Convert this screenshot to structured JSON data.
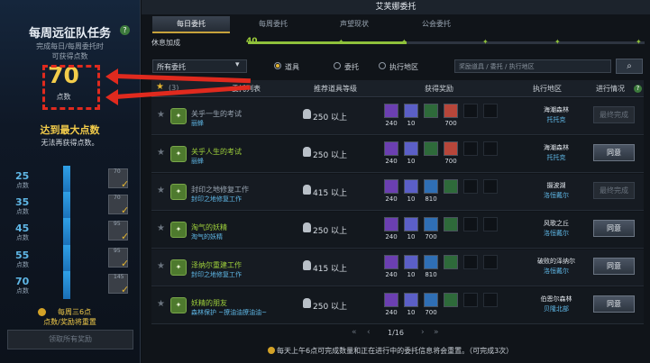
{
  "left": {
    "title": "每周远征队任务",
    "subtitle1": "完成每日/每周委托时",
    "subtitle2": "可获得点数",
    "points": "70",
    "points_unit": "点数",
    "maxed": "达到最大点数",
    "maxed_sub": "无法再获得点数。",
    "tiers": [
      {
        "num": "25",
        "unit": "点数",
        "count": "70"
      },
      {
        "num": "35",
        "unit": "点数",
        "count": "70"
      },
      {
        "num": "45",
        "unit": "点数",
        "count": "95"
      },
      {
        "num": "55",
        "unit": "点数",
        "count": "95"
      },
      {
        "num": "70",
        "unit": "点数",
        "count": "145"
      }
    ],
    "reset_note1": "每周三6点",
    "reset_note2": "点数/奖励将重置",
    "claim_all": "领取所有奖励"
  },
  "main": {
    "window_title": "艾芙娜委托",
    "tabs": [
      "每日委托",
      "每周委托",
      "声望现状",
      "公会委托"
    ],
    "rest_label": "休息加成",
    "rest_value": "40",
    "rest_fraction": 0.4,
    "filter": "所有委托",
    "radios": [
      "道具",
      "委托",
      "执行地区"
    ],
    "search_placeholder": "奖励道具 / 委托 / 执行地区",
    "header": {
      "count": "(3)",
      "list": "委托列表",
      "level": "推荐道具等级",
      "reward": "获得奖励",
      "region": "执行地区",
      "status": "进行情况"
    },
    "rows": [
      {
        "name": "关乎一生的考试",
        "giver": "丽蜂",
        "level": "250 以上",
        "rewards": [
          {
            "q": "240",
            "c": "#6b3fb1"
          },
          {
            "q": "10",
            "c": "#5b5fc7"
          },
          {
            "q": "",
            "c": "#2e6a3a"
          },
          {
            "q": "700",
            "c": "#b7463a"
          }
        ],
        "loc": "海潮森林",
        "loc2": "托托克",
        "btn": "最终完成",
        "active": false,
        "hl": false
      },
      {
        "name": "关乎人生的考试",
        "giver": "丽蜂",
        "level": "250 以上",
        "rewards": [
          {
            "q": "240",
            "c": "#6b3fb1"
          },
          {
            "q": "10",
            "c": "#5b5fc7"
          },
          {
            "q": "",
            "c": "#2e6a3a"
          },
          {
            "q": "700",
            "c": "#b7463a"
          }
        ],
        "loc": "海潮森林",
        "loc2": "托托克",
        "btn": "同意",
        "active": true,
        "hl": true
      },
      {
        "name": "封印之地修复工作",
        "giver": "封印之地修复工作",
        "level": "415 以上",
        "rewards": [
          {
            "q": "240",
            "c": "#6b3fb1"
          },
          {
            "q": "10",
            "c": "#5b5fc7"
          },
          {
            "q": "810",
            "c": "#2f6fb5"
          },
          {
            "q": "",
            "c": "#2e6a3a"
          }
        ],
        "loc": "摄波湖",
        "loc2": "洛恒戴尔",
        "btn": "最终完成",
        "active": false,
        "hl": false
      },
      {
        "name": "淘气的妖精",
        "giver": "淘气的妖精",
        "level": "250 以上",
        "rewards": [
          {
            "q": "240",
            "c": "#6b3fb1"
          },
          {
            "q": "10",
            "c": "#5b5fc7"
          },
          {
            "q": "700",
            "c": "#2f6fb5"
          },
          {
            "q": "",
            "c": "#2e6a3a"
          }
        ],
        "loc": "风歌之丘",
        "loc2": "洛恒戴尔",
        "btn": "同意",
        "active": true,
        "hl": true
      },
      {
        "name": "泽纳尔重建工作",
        "giver": "封印之地修复工作",
        "level": "415 以上",
        "rewards": [
          {
            "q": "240",
            "c": "#6b3fb1"
          },
          {
            "q": "10",
            "c": "#5b5fc7"
          },
          {
            "q": "810",
            "c": "#2f6fb5"
          },
          {
            "q": "",
            "c": "#2e6a3a"
          }
        ],
        "loc": "破败的泽纳尔",
        "loc2": "洛恒戴尔",
        "btn": "同意",
        "active": true,
        "hl": true
      },
      {
        "name": "妖精的朋友",
        "giver": "森林保护 ~撩油油撩油油~",
        "level": "250 以上",
        "rewards": [
          {
            "q": "240",
            "c": "#6b3fb1"
          },
          {
            "q": "10",
            "c": "#5b5fc7"
          },
          {
            "q": "700",
            "c": "#2f6fb5"
          },
          {
            "q": "",
            "c": "#2e6a3a"
          }
        ],
        "loc": "伯恩尔森林",
        "loc2": "贝隆北部",
        "btn": "同意",
        "active": true,
        "hl": true
      }
    ],
    "pager": "1/16",
    "bottom_note": "每天上午6点可完成数量和正在进行中的委托信息将会重置。（可完成3次）"
  }
}
